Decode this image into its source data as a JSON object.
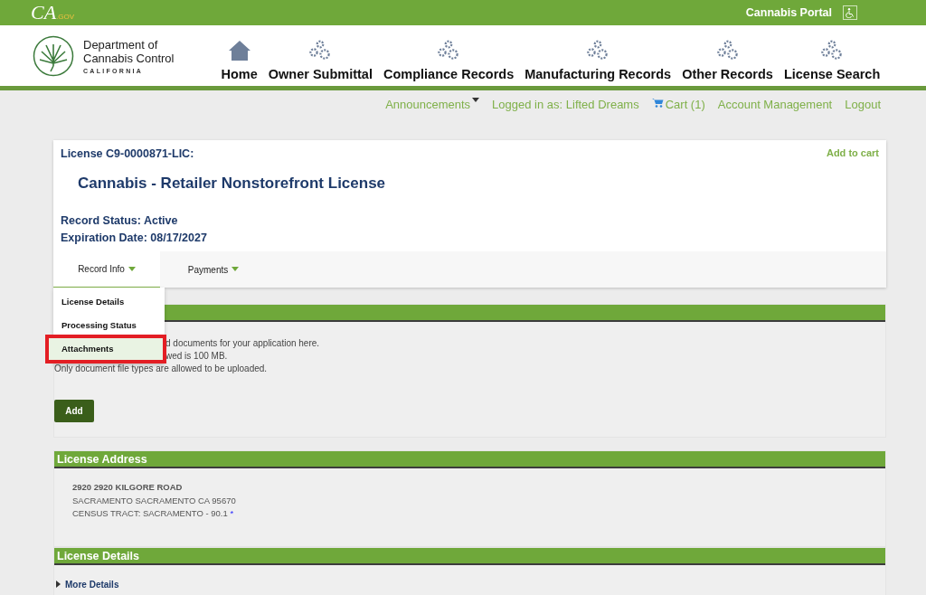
{
  "top_bar": {
    "logo": "CA",
    "logo_suffix": ".GOV",
    "portal": "Cannabis Portal"
  },
  "header": {
    "org_line1": "Department of",
    "org_line2": "Cannabis Control",
    "org_state": "CALIFORNIA",
    "nav": [
      {
        "label": "Home",
        "kind": "home"
      },
      {
        "label": "Owner Submittal",
        "kind": "gears"
      },
      {
        "label": "Compliance Records",
        "kind": "gears"
      },
      {
        "label": "Manufacturing Records",
        "kind": "gears"
      },
      {
        "label": "Other Records",
        "kind": "gears"
      },
      {
        "label": "License Search",
        "kind": "gears"
      }
    ]
  },
  "user_links": [
    {
      "label": "Announcements",
      "kind": "dropdown"
    },
    {
      "label": "Logged in as: Lifted Dreams",
      "kind": "text"
    },
    {
      "label": "Cart (1)",
      "kind": "cart"
    },
    {
      "label": "Account Management",
      "kind": "link"
    },
    {
      "label": "Logout",
      "kind": "link"
    }
  ],
  "record": {
    "license": "License C9-0000871-LIC:",
    "add_to_cart": "Add to cart",
    "title": "Cannabis - Retailer Nonstorefront License",
    "status": "Record Status: Active",
    "expiration": "Expiration Date: 08/17/2027",
    "tabs": [
      {
        "label": "Record Info",
        "selected": true
      },
      {
        "label": "Payments",
        "selected": false
      }
    ],
    "menu": [
      {
        "label": "License Details",
        "selected": false
      },
      {
        "label": "Processing Status",
        "selected": false
      },
      {
        "label": "Attachments",
        "selected": true
      }
    ]
  },
  "attachments": {
    "lines": [
      "d documents for your application here.",
      "wed is 100 MB.",
      "Only document file types are allowed to be uploaded."
    ],
    "add_button": "Add"
  },
  "address": {
    "heading": "License Address",
    "lines": [
      "2920 2920 KILGORE ROAD",
      "SACRAMENTO SACRAMENTO CA 95670",
      "CENSUS TRACT: SACRAMENTO - 90.1"
    ],
    "marker": "*"
  },
  "details": {
    "heading": "License Details",
    "toggle": "More Details",
    "expanded": false
  }
}
